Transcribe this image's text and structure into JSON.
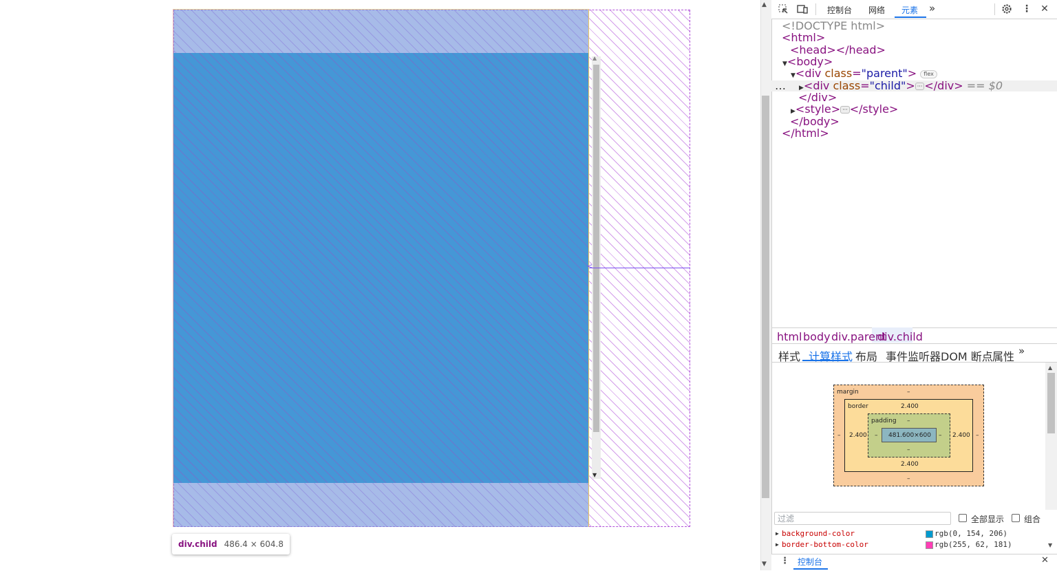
{
  "tooltip": {
    "element": "div.child",
    "size": "486.4 × 604.8"
  },
  "devtools": {
    "toolbar": {
      "inspect_icon": "inspect-element-icon",
      "device_icon": "device-toolbar-icon",
      "tabs": [
        "控制台",
        "网络",
        "元素"
      ],
      "more": "»",
      "settings_icon": "gear-icon",
      "menu": "⋮",
      "close": "✕"
    },
    "dom": {
      "doctype": "<!DOCTYPE html>",
      "html_open": "<html>",
      "head": "<head></head>",
      "body_open": "<body>",
      "parent_tag": "div",
      "parent_attr": "class",
      "parent_val": "\"parent\"",
      "flex_badge": "flex",
      "child_tag": "div",
      "child_attr": "class",
      "child_val": "\"child\"",
      "child_close": "</div>",
      "selected_marker": "== $0",
      "div_close": "</div>",
      "style_open": "<style>",
      "style_close": "</style>",
      "body_close": "</body>",
      "html_close": "</html>",
      "row_dots": "…"
    },
    "breadcrumbs": [
      "html",
      "body",
      "div.parent",
      "div.child"
    ],
    "sub_tabs": [
      "样式",
      "计算样式",
      "布局",
      "事件监听器",
      "DOM 断点",
      "属性"
    ],
    "box_model": {
      "margin_label": "margin",
      "margin_top": "–",
      "margin_bottom": "–",
      "margin_left": "–",
      "margin_right": "–",
      "border_label": "border",
      "border_top": "2.400",
      "border_bottom": "2.400",
      "border_left": "2.400",
      "border_right": "2.400",
      "padding_label": "padding",
      "padding_top": "–",
      "padding_bottom": "–",
      "padding_left": "–",
      "padding_right": "–",
      "content": "481.600×600"
    },
    "filter": {
      "placeholder": "过滤",
      "show_all": "全部显示",
      "group": "组合"
    },
    "properties": [
      {
        "name": "background-color",
        "value": "rgb(0, 154, 206)",
        "swatch": "#009ace"
      },
      {
        "name": "border-bottom-color",
        "value": "rgb(255, 62, 181)",
        "swatch": "#ff3eb5"
      }
    ],
    "drawer": {
      "tab": "控制台",
      "menu": "⋮",
      "close": "✕"
    }
  }
}
